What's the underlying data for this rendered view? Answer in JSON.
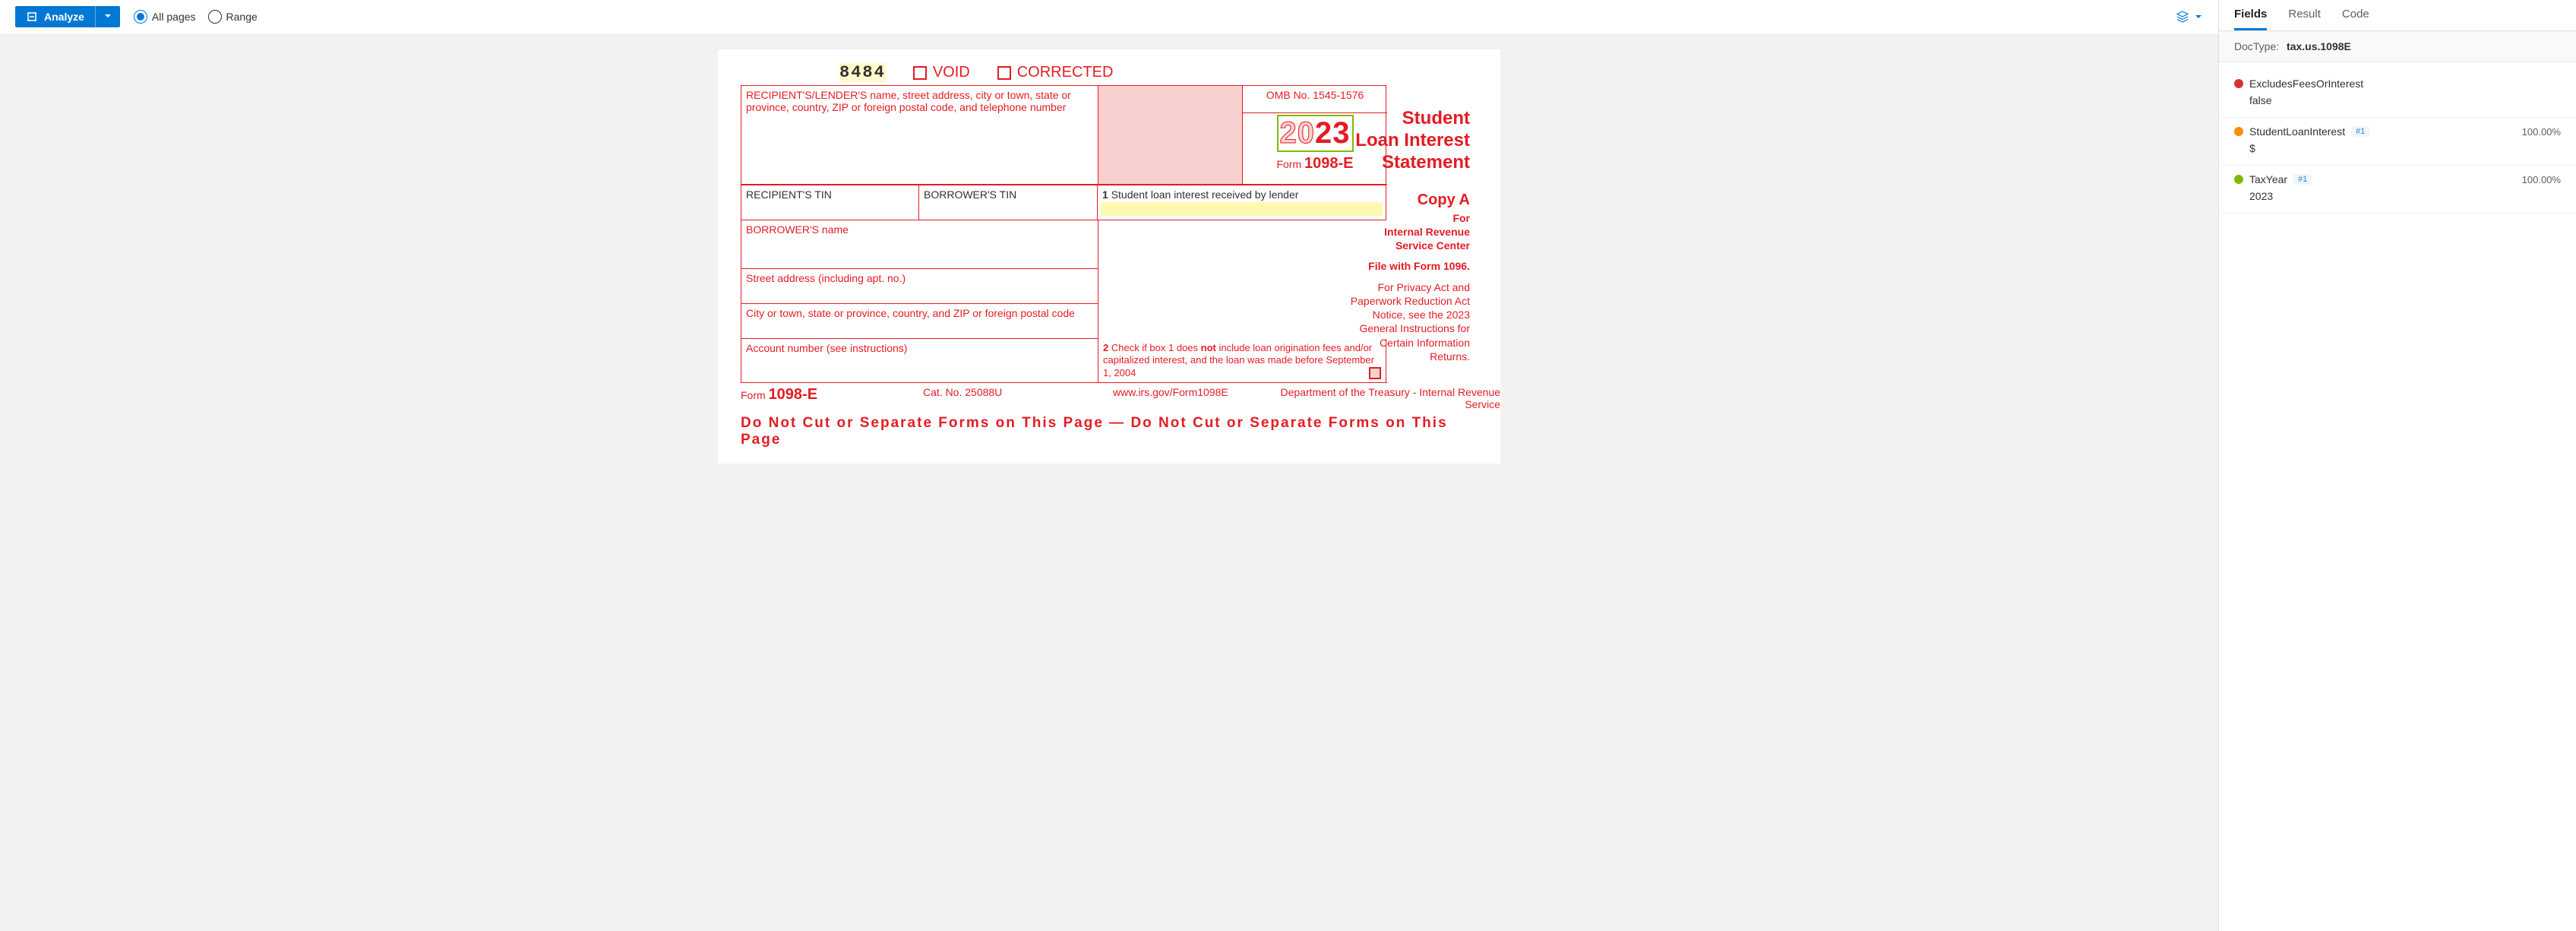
{
  "toolbar": {
    "analyze_label": "Analyze",
    "all_pages_label": "All pages",
    "range_label": "Range"
  },
  "form": {
    "seq": "8484",
    "void_label": "VOID",
    "corrected_label": "CORRECTED",
    "recipient_header": "RECIPIENT'S/LENDER'S name, street address, city or town, state or province, country, ZIP or foreign postal code, and telephone number",
    "omb": "OMB No. 1545-1576",
    "year_20": "20",
    "year_23": "23",
    "form_word": "Form",
    "form_code": "1098-E",
    "title_l1": "Student",
    "title_l2": "Loan Interest",
    "title_l3": "Statement",
    "recip_tin": "RECIPIENT'S TIN",
    "borrower_tin": "BORROWER'S TIN",
    "box1_num": "1",
    "box1_label": "Student loan interest received by lender",
    "dollar": "$",
    "borrower_name": "BORROWER'S name",
    "street": "Street address (including apt. no.)",
    "city": "City or town, state or province, country, and ZIP or foreign postal code",
    "account": "Account number (see instructions)",
    "box2_num": "2",
    "box2_a": "Check if box 1 does ",
    "box2_not": "not",
    "box2_b": " include loan origination fees and/or capitalized interest, and the loan was made before September 1, 2004",
    "copy_a": "Copy A",
    "for_irs": "For\nInternal Revenue\nService Center",
    "file_1096": "File with Form 1096.",
    "privacy": "For Privacy Act and Paperwork Reduction Act Notice, see the 2023 General Instructions for Certain Information Returns.",
    "footer_form": "Form",
    "footer_cat": "Cat. No. 25088U",
    "footer_url": "www.irs.gov/Form1098E",
    "footer_dept": "Department of the Treasury - Internal Revenue Service",
    "warn": "Do Not Cut or Separate Forms on This Page — Do Not Cut or Separate Forms on This Page"
  },
  "panel": {
    "tabs": {
      "fields": "Fields",
      "result": "Result",
      "code": "Code"
    },
    "doctype_label": "DocType:",
    "doctype_value": "tax.us.1098E",
    "fields": [
      {
        "name": "ExcludesFeesOrInterest",
        "color": "#d13438",
        "value": "false",
        "badge": "",
        "conf": ""
      },
      {
        "name": "StudentLoanInterest",
        "color": "#ff8c00",
        "value": "$",
        "badge": "#1",
        "conf": "100.00%"
      },
      {
        "name": "TaxYear",
        "color": "#7fba00",
        "value": "2023",
        "badge": "#1",
        "conf": "100.00%"
      }
    ]
  }
}
